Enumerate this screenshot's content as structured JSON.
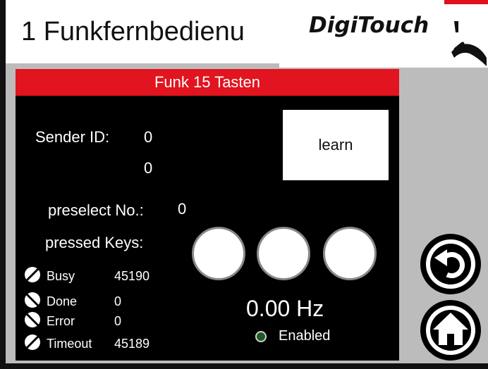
{
  "title": "1 Funkfernbedienu",
  "logo": {
    "text": "DigiTouch",
    "icon": "hand-touch-icon"
  },
  "panel": {
    "header": "Funk 15 Tasten",
    "sender_label": "Sender ID:",
    "sender_id_1": "0",
    "sender_id_2": "0",
    "learn_label": "learn",
    "preselect_label": "preselect No.:",
    "preselect_value": "0",
    "pressed_label": "pressed Keys:",
    "pressed_keys": [
      "",
      "",
      ""
    ],
    "status": [
      {
        "label": "Busy",
        "value": "45190",
        "icon": "disabled-icon"
      },
      {
        "label": "Done",
        "value": "0",
        "icon": "disabled-icon"
      },
      {
        "label": "Error",
        "value": "0",
        "icon": "disabled-icon"
      },
      {
        "label": "Timeout",
        "value": "45189",
        "icon": "disabled-icon"
      }
    ],
    "frequency": "0.00 Hz",
    "enabled_label": "Enabled"
  },
  "nav": {
    "back_icon": "back-icon",
    "home_icon": "home-icon"
  },
  "colors": {
    "header_red": "#e1141f",
    "enabled_green": "#1e5b22",
    "frame_gray": "#bcbcbc"
  }
}
